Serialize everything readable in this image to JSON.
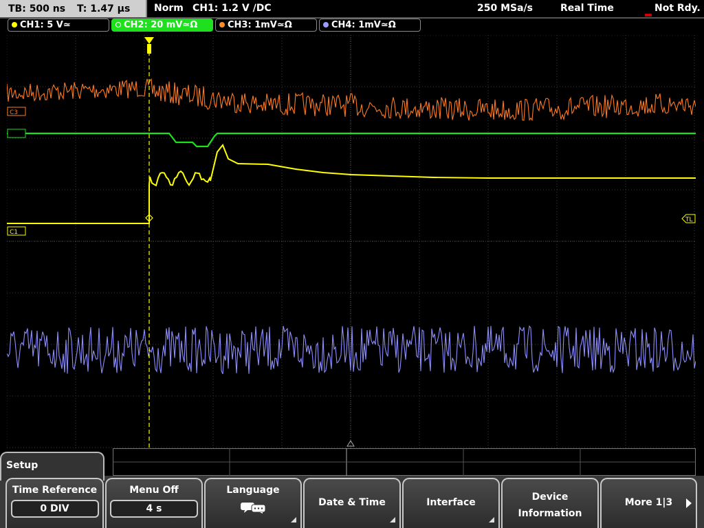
{
  "topbar": {
    "timebase": "TB: 500 ns",
    "trigger_time": "T: 1.47 µs",
    "mode": "Norm",
    "trigger": "CH1: 1.2 V ∕DC",
    "sample_rate": "250 MSa/s",
    "acq_mode": "Real Time",
    "state": "Not Rdy."
  },
  "channels": [
    {
      "label": "CH1: 5 V≃",
      "color": "#ffff00",
      "active": false
    },
    {
      "label": "CH2: 20 mV≃Ω",
      "color": "#1fe01f",
      "active": true
    },
    {
      "label": "CH3: 1mV≃Ω",
      "color": "#ff8c2a",
      "active": false
    },
    {
      "label": "CH4: 1mV≃Ω",
      "color": "#9a9aff",
      "active": false
    }
  ],
  "markers": {
    "ch3": "C3",
    "ch1": "C1",
    "trigger_level": "TL"
  },
  "colors": {
    "ch1": "#ffff00",
    "ch2": "#1fe01f",
    "ch3": "#ff7a20",
    "ch4": "#8f8fff",
    "grid": "#3a3a3a"
  },
  "menu": {
    "title": "Setup",
    "softkeys": {
      "time_reference": {
        "label": "Time Reference",
        "value": "0 DIV"
      },
      "menu_off": {
        "label": "Menu Off",
        "value": "4 s"
      },
      "language": {
        "label": "Language",
        "icon": "speech-bubbles-icon"
      },
      "date_time": {
        "label": "Date & Time"
      },
      "interface": {
        "label": "Interface"
      },
      "device_info": {
        "line1": "Device",
        "line2": "Information"
      },
      "more": {
        "label": "More 1|3"
      }
    }
  }
}
